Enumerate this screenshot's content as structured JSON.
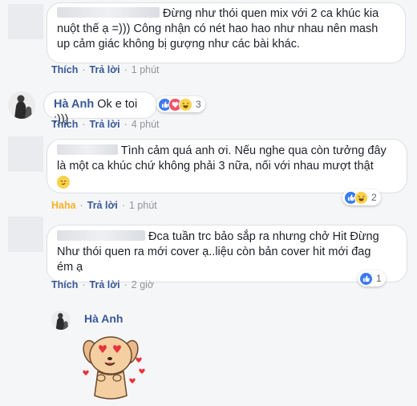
{
  "comments": [
    {
      "text_line1": "Đừng như thói quen mix với 2 ca khúc kia",
      "text_line2": "nuột thế ạ =))) Công nhận có nét hao hao như nhau nên mash",
      "text_line3": "up cảm giác không bị gượng như các bài khác.",
      "actions": {
        "like": "Thích",
        "reply": "Trả lời",
        "time": "1 phút"
      }
    },
    {
      "author": "Hà Anh",
      "text": "Ok e toi :)))",
      "reaction_count": "3",
      "actions": {
        "like": "Thích",
        "reply": "Trả lời",
        "time": "4 phút"
      }
    },
    {
      "text_line1": "Tình cảm quá anh ơi. Nếu nghe qua còn tưởng đây",
      "text_line2": "là một ca khúc chứ không phải 3 nữa, nối với nhau mượt thật",
      "reaction_count": "2",
      "actions": {
        "like": "Haha",
        "reply": "Trả lời",
        "time": "1 phút"
      }
    },
    {
      "text_line1": "Đca tuần trc bảo sắp ra nhưng chở Hit Đừng",
      "text_line2": "Như thói quen ra mới cover ạ..liệu còn bản cover hit mới đag",
      "text_line3": "ém ạ",
      "reaction_count": "1",
      "actions": {
        "like": "Thích",
        "reply": "Trả lời",
        "time": "2 giờ"
      }
    },
    {
      "author": "Hà Anh",
      "sticker": "dog-hearts-sticker"
    }
  ],
  "colors": {
    "link": "#385898",
    "meta": "#90949c",
    "haha": "#f7b125",
    "like": "#3b7af2",
    "love": "#f25268"
  }
}
